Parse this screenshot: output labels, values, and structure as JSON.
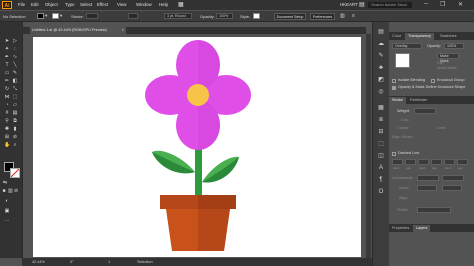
{
  "app": {
    "logo": "Ai",
    "workspace": "HKEART",
    "search_placeholder": "Search Adobe Stock"
  },
  "menu": [
    "File",
    "Edit",
    "Object",
    "Type",
    "Select",
    "Effect",
    "View",
    "Window",
    "Help"
  ],
  "control_bar": {
    "selection_state": "No Selection",
    "stroke_label": "Stroke:",
    "brush_value": "3 pt. Round",
    "opacity_label": "Opacity:",
    "opacity_value": "100%",
    "style_label": "Style:",
    "doc_setup_label": "Document Setup",
    "preferences_label": "Preferences",
    "fill_color": "#000000",
    "stroke_color": "#ffffff"
  },
  "document": {
    "tab_title": "Untitled-1.ai @ 42.44% (RGB/GPU Preview)",
    "close_glyph": "×"
  },
  "status": {
    "zoom": "42.44%",
    "rotation": "0°",
    "page": "1",
    "mode": "Selection"
  },
  "panels": {
    "top_tabs": [
      "Color",
      "Transparency",
      "Swatches"
    ],
    "blend_mode": "Overlay",
    "opacity_label": "Opacity:",
    "opacity_value": "100%",
    "make_mask_label": "Make Mask",
    "clip_label": "Clip",
    "invert_mask_label": "Invert Mask",
    "isolate_blending": "Isolate Blending",
    "knockout_group": "Knockout Group",
    "opacity_mask_knockout": "Opacity & Mask Define Knockout Shape",
    "stroke_tabs": [
      "Stroke",
      "Pathfinder"
    ],
    "weight_label": "Weight:",
    "cap_label": "Cap:",
    "corner_label": "Corner:",
    "limit_label": "Limit:",
    "align_label": "Align Stroke:",
    "dashed_line_label": "Dashed Line",
    "dash_labels": [
      "dash",
      "gap",
      "dash",
      "gap",
      "dash",
      "gap"
    ],
    "arrowheads_label": "Arrowheads:",
    "scale_label": "Scale:",
    "align_arrow_label": "Align:",
    "profile_label": "Profile:",
    "bottom_tabs": [
      "Properties",
      "Layers"
    ]
  },
  "artwork": {
    "petal_color": "#df4fe8",
    "center_color": "#f7c448",
    "stem_color": "#2d9a3e",
    "leaf_light": "#4ab04f",
    "leaf_dark": "#2b8a3a",
    "pot_color": "#c9521b",
    "pot_rim": "#b6471a",
    "pot_shadow": "#a43e15"
  }
}
